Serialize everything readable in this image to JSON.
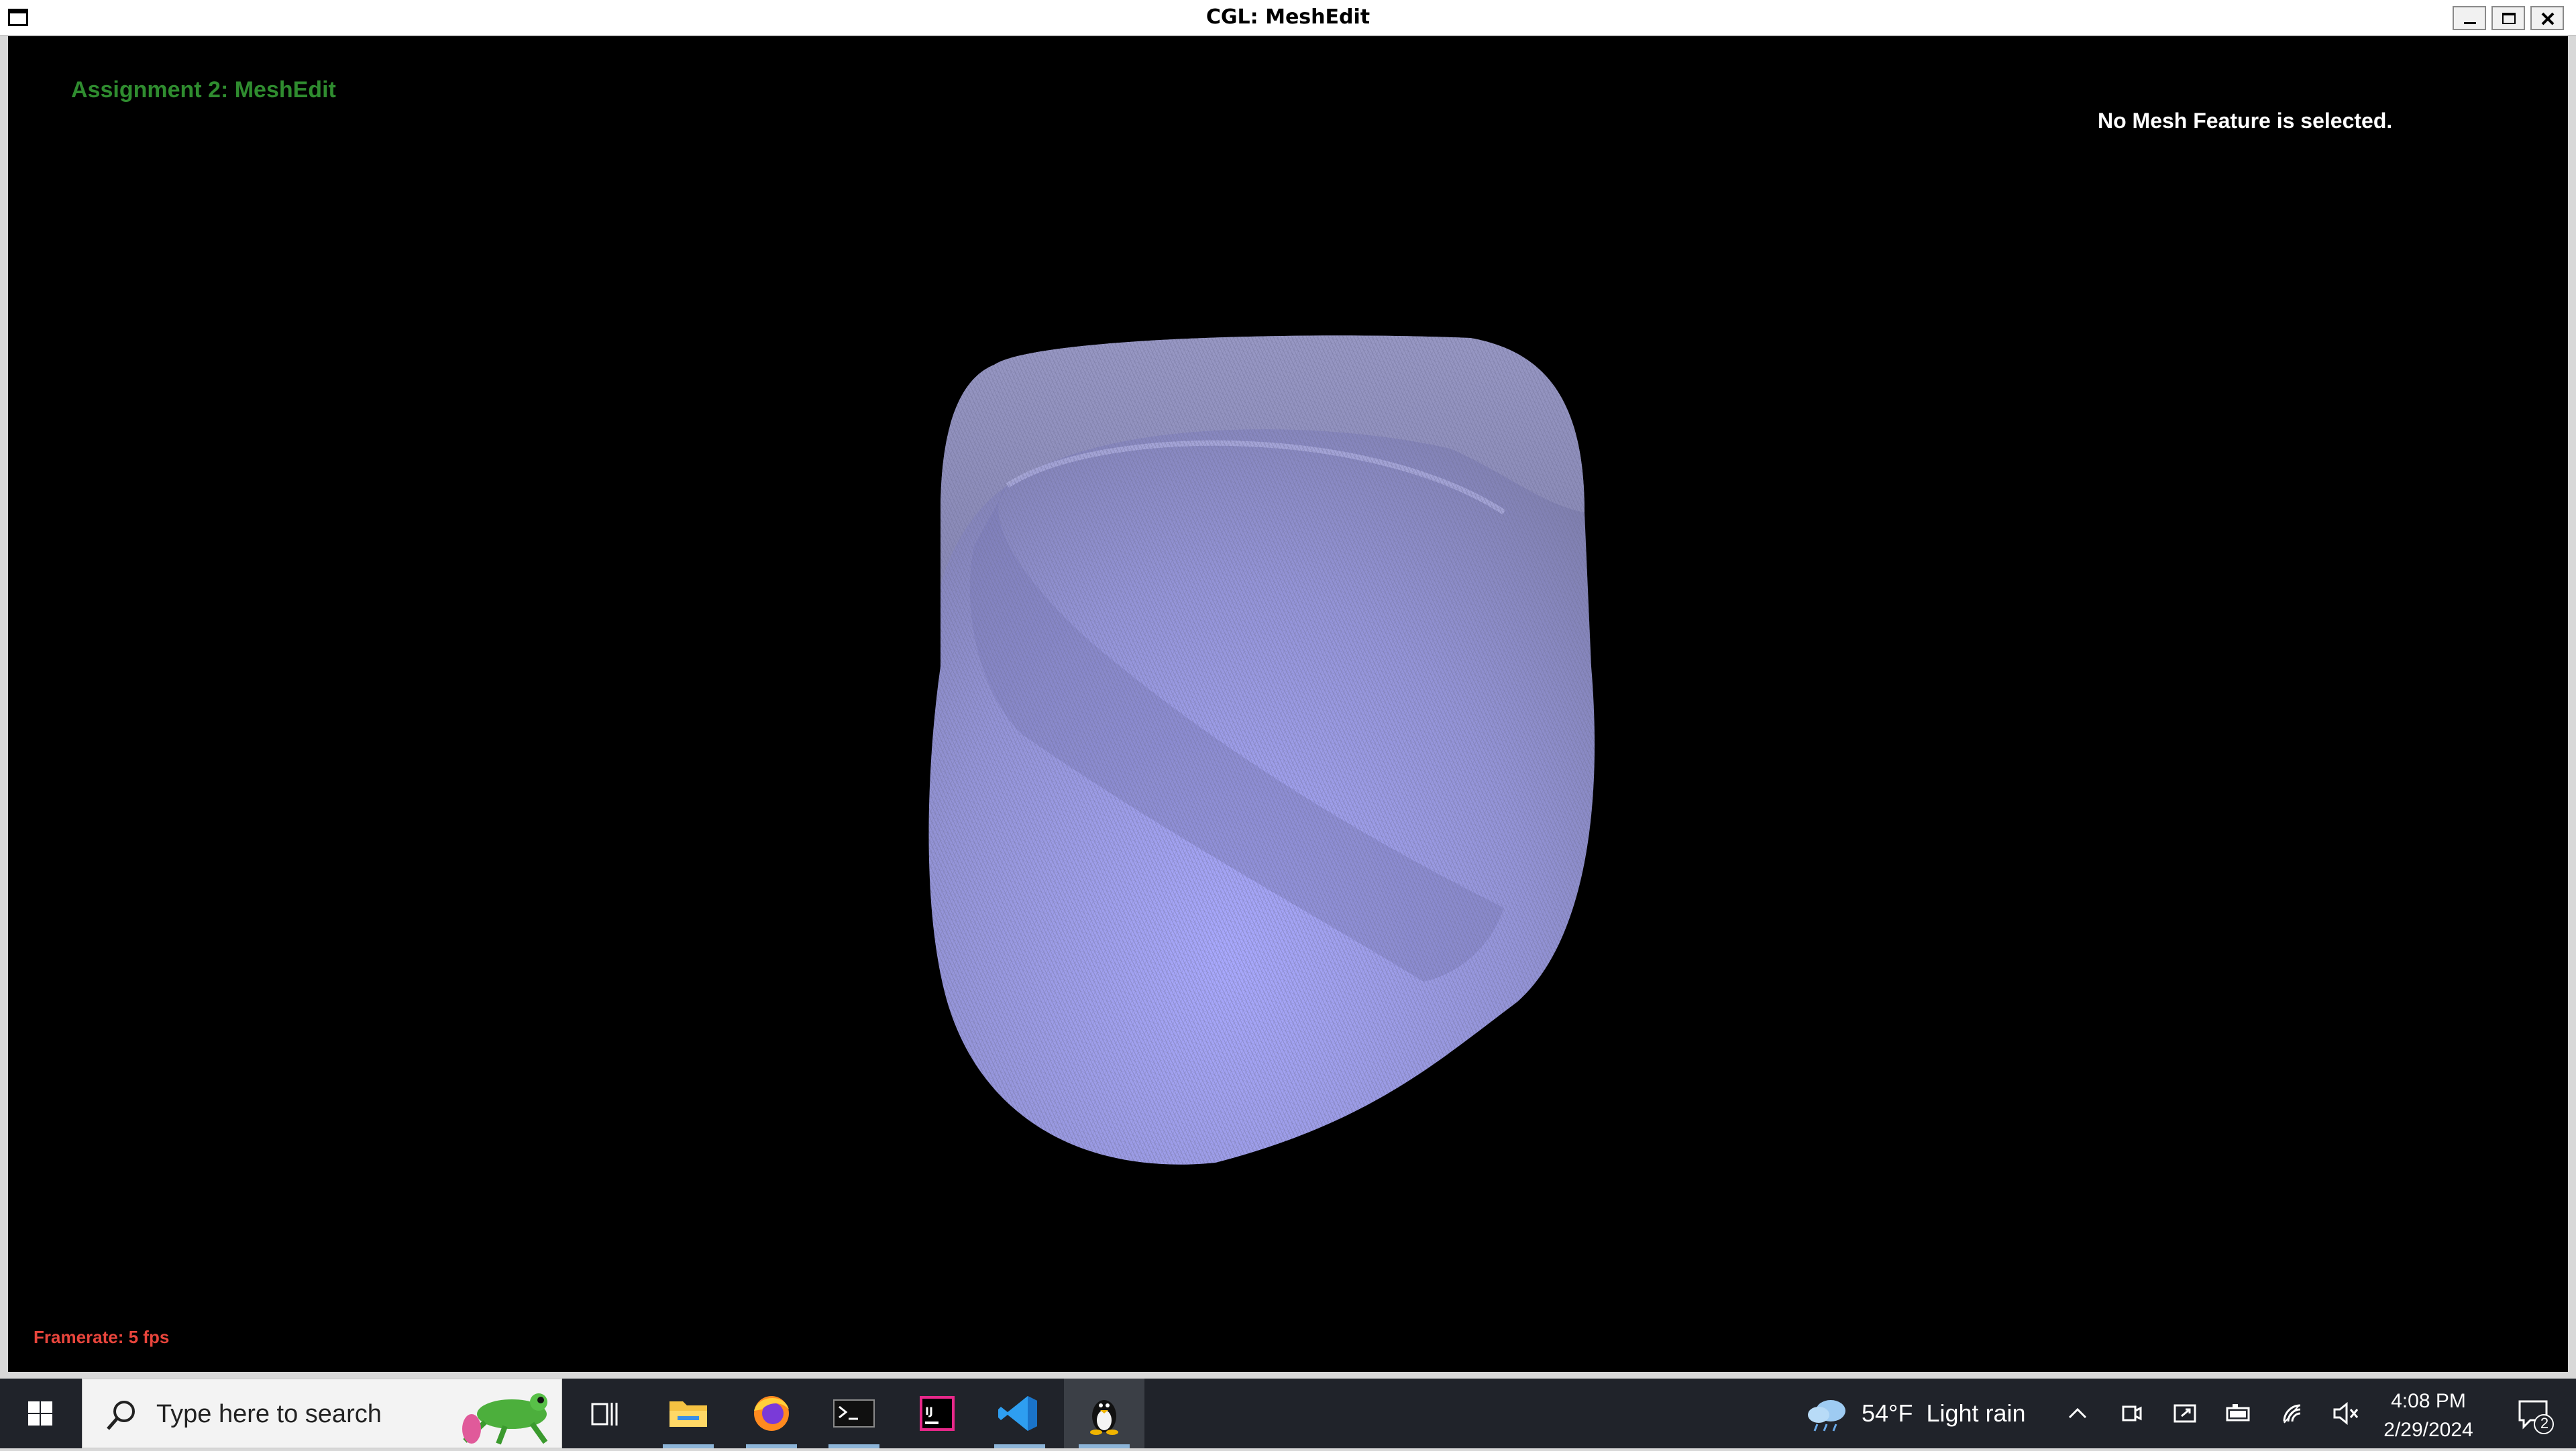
{
  "window": {
    "title": "CGL: MeshEdit"
  },
  "viewport": {
    "assignment_title": "Assignment 2: MeshEdit",
    "selection_status": "No Mesh Feature is selected.",
    "framerate": "Framerate: 5 fps",
    "mesh_color": "#9c9cf0",
    "background_color": "#000000"
  },
  "taskbar": {
    "search_placeholder": "Type here to search",
    "apps": [
      {
        "name": "file-explorer",
        "running": true
      },
      {
        "name": "firefox",
        "running": true
      },
      {
        "name": "terminal",
        "running": true
      },
      {
        "name": "intellij",
        "running": false
      },
      {
        "name": "vscode",
        "running": true
      },
      {
        "name": "linux-app",
        "running": true,
        "active": true
      }
    ],
    "weather": {
      "temperature": "54°F",
      "condition": "Light rain"
    },
    "clock": {
      "time": "4:08 PM",
      "date": "2/29/2024"
    },
    "notification_count": "2"
  }
}
